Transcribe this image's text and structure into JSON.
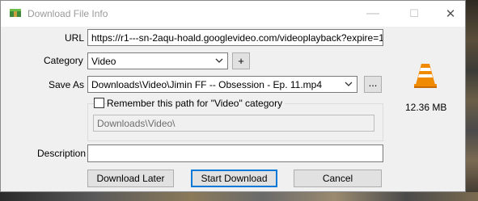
{
  "window": {
    "title": "Download File Info",
    "controls": {
      "minimize": "—",
      "maximize": "☐",
      "close": "✕"
    }
  },
  "form": {
    "url_label": "URL",
    "url_value": "https://r1---sn-2aqu-hoald.googlevideo.com/videoplayback?expire=15870",
    "category_label": "Category",
    "category_value": "Video",
    "add_category": "+",
    "saveas_label": "Save As",
    "saveas_value": "Downloads\\Video\\Jimin FF -- Obsession - Ep. 11.mp4",
    "browse": "...",
    "remember_label": "Remember this path for \"Video\" category",
    "remember_checked": false,
    "remember_path": "Downloads\\Video\\",
    "description_label": "Description",
    "description_value": ""
  },
  "file": {
    "size": "12.36  MB",
    "icon": "vlc-cone-icon"
  },
  "buttons": {
    "download_later": "Download Later",
    "start_download": "Start Download",
    "cancel": "Cancel"
  },
  "colors": {
    "accent": "#0078d7",
    "vlc_orange": "#f08a00"
  }
}
